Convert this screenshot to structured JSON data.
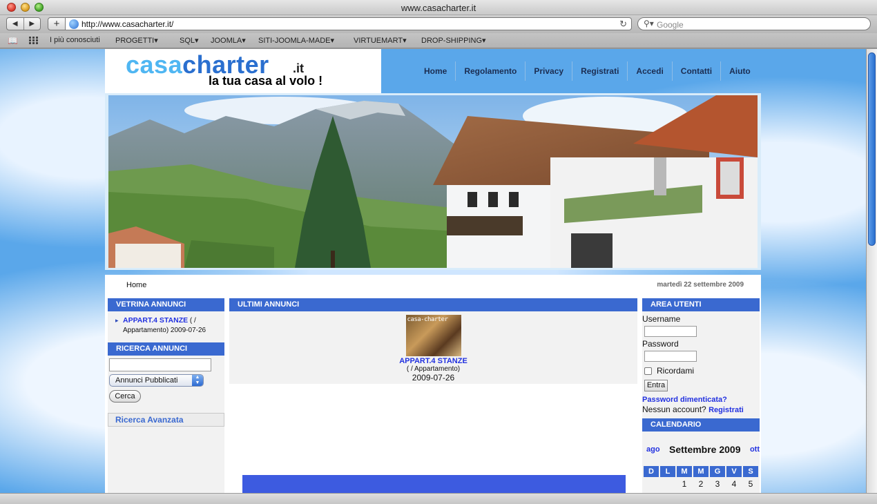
{
  "window": {
    "title": "www.casacharter.it"
  },
  "toolbar": {
    "url": "http://www.casacharter.it/",
    "search_placeholder": "Google"
  },
  "bookmarks": [
    "I più conosciuti",
    "PROGETTI▾",
    "SQL▾",
    "JOOMLA▾",
    "SITI-JOOMLA-MADE▾",
    "VIRTUEMART▾",
    "DROP-SHIPPING▾"
  ],
  "site": {
    "logo_part1": "casa",
    "logo_part2": "charter",
    "logo_tld": ".it",
    "tagline": "la tua casa al volo !",
    "nav": [
      "Home",
      "Regolamento",
      "Privacy",
      "Registrati",
      "Accedi",
      "Contatti",
      "Aiuto"
    ],
    "breadcrumb": "Home",
    "date": "martedì 22 settembre 2009"
  },
  "left": {
    "vetrina_title": "VETRINA ANNUNCI",
    "vetrina_link": "APPART.4 STANZE",
    "vetrina_meta1": " ( /",
    "vetrina_meta2": "Appartamento) 2009-07-26",
    "ricerca_title": "RICERCA ANNUNCI",
    "select_value": "Annunci Pubblicati",
    "search_button": "Cerca",
    "advanced_link": "Ricerca Avanzata"
  },
  "middle": {
    "title": "ULTIMI ANNUNCI",
    "thumb_watermark": "casa-charter",
    "listing_title": "APPART.4 STANZE",
    "listing_type": "( / Appartamento)",
    "listing_date": "2009-07-26"
  },
  "right": {
    "area_title": "AREA UTENTI",
    "username_label": "Username",
    "password_label": "Password",
    "remember_label": "Ricordami",
    "login_button": "Entra",
    "forgot_link": "Password dimenticata?",
    "no_account": "Nessun account?",
    "register_link": "Registrati",
    "calendar_title": "CALENDARIO",
    "prev_month": "ago",
    "month": "Settembre 2009",
    "next_month": "ott",
    "weekdays": [
      "D",
      "L",
      "M",
      "M",
      "G",
      "V",
      "S"
    ],
    "first_row": [
      "",
      "",
      "1",
      "2",
      "3",
      "4",
      "5"
    ]
  }
}
